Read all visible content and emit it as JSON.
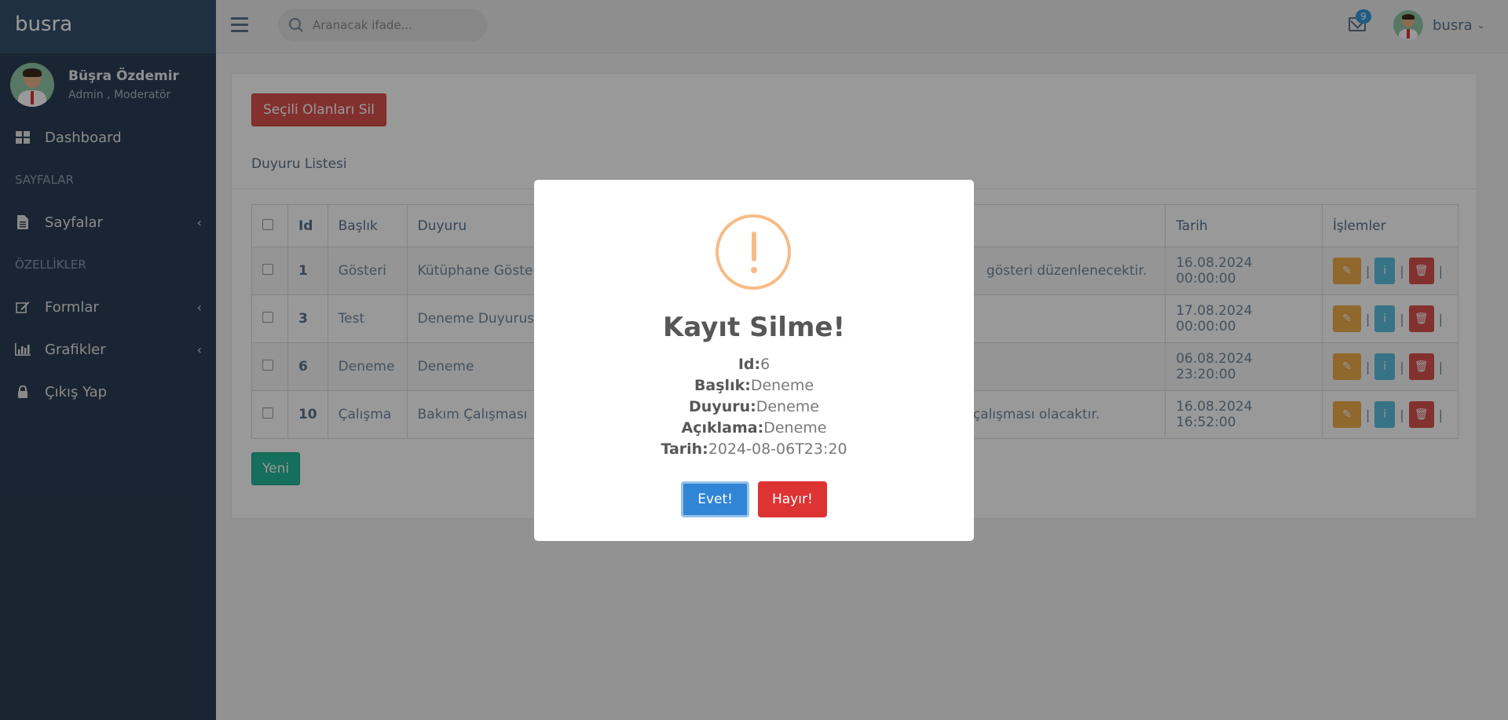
{
  "sidebar": {
    "brand": "busra",
    "profile": {
      "name": "Büşra Özdemir",
      "role": "Admin , Moderatör"
    },
    "items": [
      {
        "label": "Dashboard",
        "icon": "dashboard-icon"
      },
      {
        "header": "SAYFALAR"
      },
      {
        "label": "Sayfalar",
        "icon": "file-icon"
      },
      {
        "header": "ÖZELLİKLER"
      },
      {
        "label": "Formlar",
        "icon": "edit-icon"
      },
      {
        "label": "Grafikler",
        "icon": "bar-chart-icon"
      },
      {
        "label": "Çıkış Yap",
        "icon": "lock-icon"
      }
    ]
  },
  "topnav": {
    "search_placeholder": "Aranacak ifade...",
    "mail_count": "9",
    "user_name": "busra"
  },
  "panel": {
    "delete_selected_label": "Seçili Olanları Sil",
    "title": "Duyuru Listesi",
    "new_label": "Yeni",
    "table": {
      "columns": [
        "Id",
        "Başlık",
        "Duyuru",
        "Tarih",
        "İşlemler"
      ],
      "rows": [
        {
          "id": "1",
          "baslik": "Gösteri",
          "duyuru": "Kütüphane Göster",
          "aciklama": "gösteri düzenlenecektir.",
          "tarih": "16.08.2024 00:00:00"
        },
        {
          "id": "3",
          "baslik": "Test",
          "duyuru": "Deneme Duyurusu",
          "aciklama": "",
          "tarih": "17.08.2024 00:00:00"
        },
        {
          "id": "6",
          "baslik": "Deneme",
          "duyuru": "Deneme",
          "aciklama": "",
          "tarih": "06.08.2024 23:20:00"
        },
        {
          "id": "10",
          "baslik": "Çalışma",
          "duyuru": "Bakım Çalışması",
          "aciklama": "m çalışması olacaktır.",
          "tarih": "16.08.2024 16:52:00"
        }
      ],
      "separator": "|"
    }
  },
  "modal": {
    "title": "Kayıt Silme!",
    "fields": [
      {
        "label": "Id:",
        "value": "6"
      },
      {
        "label": "Başlık:",
        "value": "Deneme"
      },
      {
        "label": "Duyuru:",
        "value": "Deneme"
      },
      {
        "label": "Açıklama:",
        "value": "Deneme"
      },
      {
        "label": "Tarih:",
        "value": "2024-08-06T23:20"
      }
    ],
    "confirm_label": "Evet!",
    "cancel_label": "Hayır!"
  },
  "colors": {
    "sidebar_bg": "#2a3f54",
    "danger": "#d9534f",
    "success": "#26b99a",
    "confirm": "#3085d6",
    "warning_icon": "#f8bb86"
  }
}
